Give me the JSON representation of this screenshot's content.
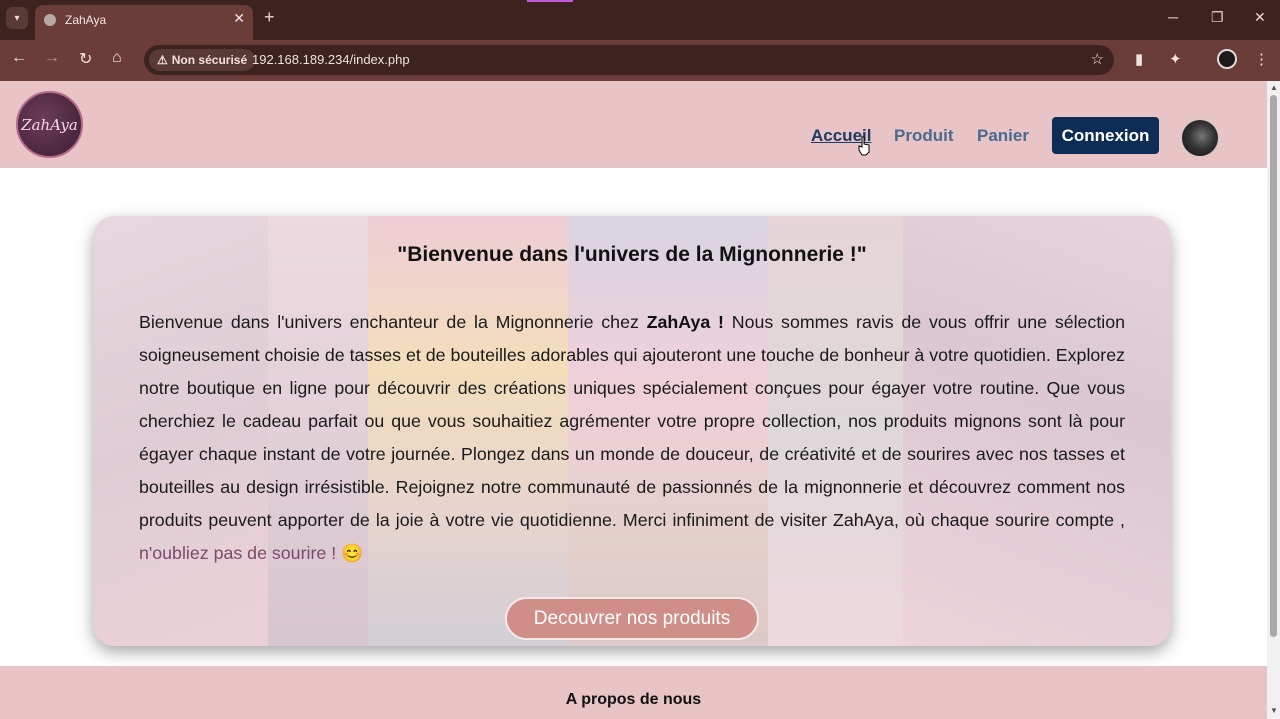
{
  "browser": {
    "tab_title": "ZahAya",
    "security_label": "Non sécurisé",
    "url": "192.168.189.234/index.php"
  },
  "site": {
    "logo_text": "ZahAya",
    "nav": [
      {
        "label": "Accueil",
        "active": true
      },
      {
        "label": "Produit"
      },
      {
        "label": "Panier"
      }
    ],
    "login_label": "Connexion"
  },
  "hero": {
    "title": "\"Bienvenue dans l'univers de la Mignonnerie !\"",
    "text_before": "Bienvenue dans l'univers enchanteur de la Mignonnerie chez ",
    "brand": "ZahAya !",
    "text_after": " Nous sommes ravis de vous offrir une sélection soigneusement choisie de tasses et de bouteilles adorables qui ajouteront une touche de bonheur à votre quotidien. Explorez notre boutique en ligne pour découvrir des créations uniques spécialement conçues pour égayer votre routine. Que vous cherchiez le cadeau parfait ou que vous souhaitiez agrémenter votre propre collection, nos produits mignons sont là pour égayer chaque instant de votre journée. Plongez dans un monde de douceur, de créativité et de sourires avec nos tasses et bouteilles au design irrésistible. Rejoignez notre communauté de passionnés de la mignonnerie et découvrez comment nos produits peuvent apporter de la joie à votre vie quotidienne. Merci infiniment de visiter ZahAya, où chaque sourire compte ,",
    "closing": "n'oubliez pas de sourire !",
    "emoji": "😊",
    "button_label": "Decouvrer nos produits"
  },
  "footer": {
    "about_label": "A propos de nous"
  },
  "colors": {
    "header_bg": "#e9c4c6",
    "nav_active": "#1c3a63",
    "nav_link": "#4a6b8f",
    "login_bg": "#0d2d57",
    "discover_btn": "#cf8e87"
  },
  "icons": {
    "back": "arrow-left-icon",
    "forward": "arrow-right-icon",
    "reload": "reload-icon",
    "home": "home-icon",
    "warning": "warning-icon",
    "bookmark": "star-icon"
  }
}
